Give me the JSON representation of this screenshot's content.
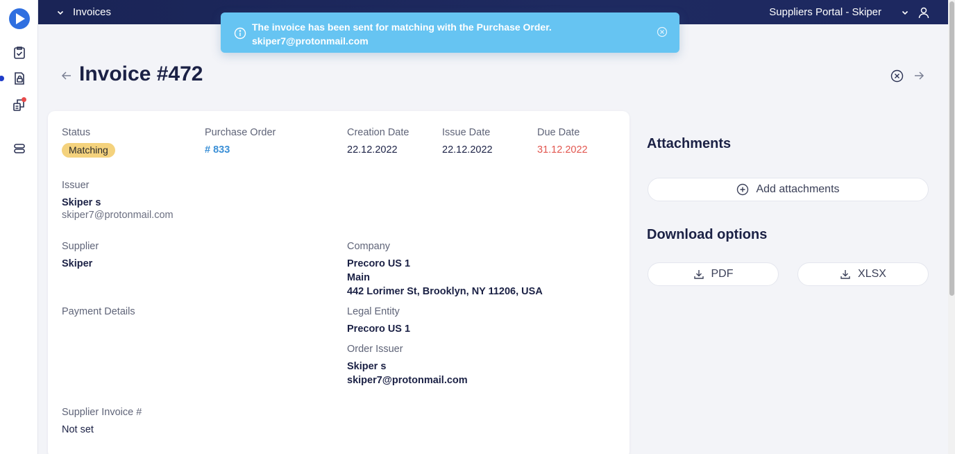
{
  "topbar": {
    "breadcrumb": "Invoices",
    "portal_name": "Suppliers Portal - Skiper"
  },
  "toast": {
    "message_line1": "The invoice has been sent for matching with the Purchase Order.",
    "message_line2": "skiper7@protonmail.com"
  },
  "header": {
    "title": "Invoice #472"
  },
  "invoice": {
    "status_label": "Status",
    "status_value": "Matching",
    "po_label": "Purchase Order",
    "po_value": "# 833",
    "creation_label": "Creation Date",
    "creation_value": "22.12.2022",
    "issue_label": "Issue Date",
    "issue_value": "22.12.2022",
    "due_label": "Due Date",
    "due_value": "31.12.2022",
    "issuer_label": "Issuer",
    "issuer_name": "Skiper s",
    "issuer_email": "skiper7@protonmail.com",
    "supplier_label": "Supplier",
    "supplier_value": "Skiper",
    "company_label": "Company",
    "company_name": "Precoro US 1",
    "company_branch": "Main",
    "company_address": "442 Lorimer St, Brooklyn, NY 11206, USA",
    "payment_label": "Payment Details",
    "legal_label": "Legal Entity",
    "legal_value": "Precoro US 1",
    "order_issuer_label": "Order Issuer",
    "order_issuer_name": "Skiper s",
    "order_issuer_email": "skiper7@protonmail.com",
    "supplier_invoice_label": "Supplier Invoice #",
    "supplier_invoice_value": "Not set"
  },
  "side": {
    "attachments_title": "Attachments",
    "add_attachments": "Add attachments",
    "download_title": "Download options",
    "pdf": "PDF",
    "xlsx": "XLSX"
  },
  "colors": {
    "topbar": "#1e2a60",
    "toast": "#66c4f2",
    "status_pill": "#f4d27d",
    "link": "#3a8fd6",
    "due_date": "#e2564f"
  },
  "icons": {
    "logo": "play-logo-icon",
    "nav": [
      "clipboard-check-icon",
      "invoice-lock-icon",
      "documents-icon",
      "layers-icon"
    ]
  }
}
